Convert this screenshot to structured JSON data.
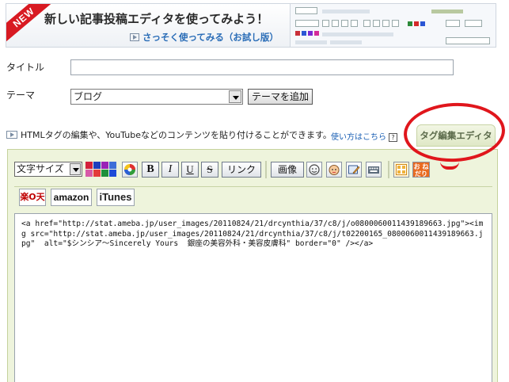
{
  "banner": {
    "new_label": "NEW",
    "title": "新しい記事投稿エディタを使ってみよう！",
    "cta": "さっそく使ってみる（お試し版）"
  },
  "form": {
    "title_label": "タイトル",
    "title_value": "",
    "theme_label": "テーマ",
    "theme_selected": "ブログ",
    "add_theme_label": "テーマを追加"
  },
  "notice": {
    "text": "HTMLタグの編集や、YouTubeなどのコンテンツを貼り付けることができます。",
    "howto_link": "使い方はこちら",
    "help_icon": "?"
  },
  "tabs": {
    "tag_editor": "タグ編集エディタ"
  },
  "toolbar": {
    "font_size": "文字サイズ",
    "bold": "B",
    "italic": "I",
    "underline": "U",
    "strike": "S",
    "link": "リンク",
    "image": "画像",
    "palette_colors": [
      "#d3213a",
      "#1e3fbd",
      "#9a23b7",
      "#3e6fd8",
      "#d75aa8",
      "#e33b3b",
      "#1e8f3a",
      "#1e4bd8"
    ],
    "accent_color": "#e0161c"
  },
  "shops": {
    "rakuten": "楽O天",
    "amazon": "amazon",
    "itunes": "iTunes"
  },
  "editor": {
    "content": "<a href=\"http://stat.ameba.jp/user_images/20110824/21/drcynthia/37/c8/j/o0800060011439189663.jpg\"><img src=\"http://stat.ameba.jp/user_images/20110824/21/drcynthia/37/c8/j/t02200165_0800060011439189663.jpg\"  alt=\"$シンシア～Sincerely Yours  銀座の美容外科・美容皮膚科\" border=\"0\" /></a>"
  }
}
